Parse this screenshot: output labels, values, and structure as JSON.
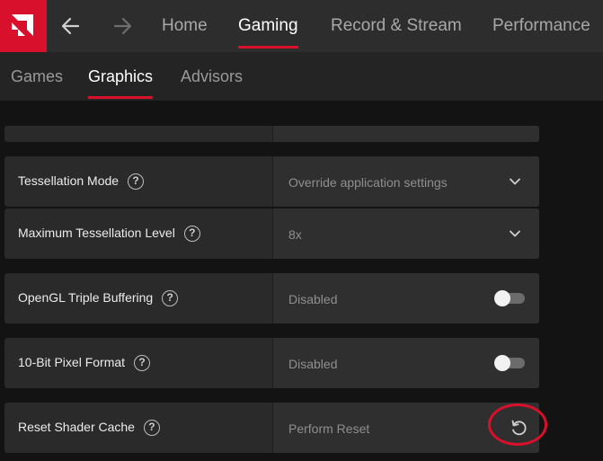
{
  "top_nav": {
    "tabs": [
      {
        "label": "Home"
      },
      {
        "label": "Gaming"
      },
      {
        "label": "Record & Stream"
      },
      {
        "label": "Performance"
      }
    ],
    "active_tab": "Gaming"
  },
  "sub_nav": {
    "tabs": [
      {
        "label": "Games"
      },
      {
        "label": "Graphics"
      },
      {
        "label": "Advisors"
      }
    ],
    "active_tab": "Graphics"
  },
  "settings": [
    {
      "label": "Tessellation Mode",
      "value": "Override application settings",
      "control": "dropdown"
    },
    {
      "label": "Maximum Tessellation Level",
      "value": "8x",
      "control": "dropdown"
    },
    {
      "label": "OpenGL Triple Buffering",
      "value": "Disabled",
      "control": "toggle",
      "on": false
    },
    {
      "label": "10-Bit Pixel Format",
      "value": "Disabled",
      "control": "toggle",
      "on": false
    },
    {
      "label": "Reset Shader Cache",
      "value": "Perform Reset",
      "control": "reset-button"
    }
  ],
  "help_glyph": "?",
  "colors": {
    "accent": "#d9102b",
    "topbar": "#2d2d2d",
    "subbar": "#242424",
    "row_bg": "#2a2a2a"
  }
}
